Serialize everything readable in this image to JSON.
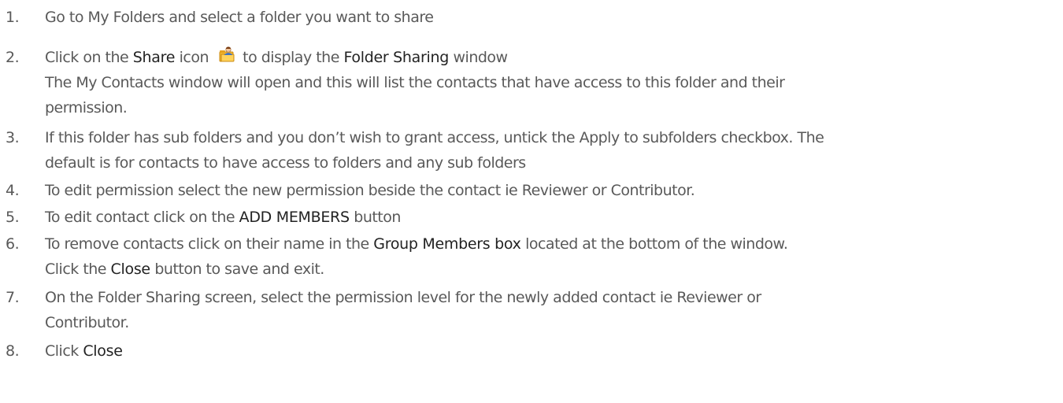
{
  "steps": [
    {
      "number": "1.",
      "parts": [
        "Go to My Folders and select a folder you want to share"
      ]
    },
    {
      "number": "2.",
      "parts": [
        "Click on the ",
        "Share",
        " icon ",
        " to display the ",
        "Folder Sharing",
        " window"
      ],
      "icon": "share-folder-icon",
      "continuation": [
        "The My Contacts window will open and this will list the contacts that have access to this folder and their",
        "permission."
      ]
    },
    {
      "number": "3.",
      "lines": [
        "If this folder has sub folders and you don’t wish to grant access, untick the Apply to subfolders checkbox. The",
        "default is for contacts to have access to folders and any sub folders"
      ]
    },
    {
      "number": "4.",
      "parts": [
        "To edit permission select the new permission beside the contact ie Reviewer or Contributor."
      ]
    },
    {
      "number": "5.",
      "parts": [
        "To edit contact click on the ",
        "ADD MEMBERS",
        " button"
      ]
    },
    {
      "number": "6.",
      "parts": [
        "To remove contacts click on their name in the ",
        "Group Members box",
        " located at the bottom of the window."
      ],
      "continuation_parts": [
        "Click the ",
        "Close",
        " button to save and exit."
      ]
    },
    {
      "number": "7.",
      "lines": [
        "On the Folder Sharing screen, select the permission level for the newly added contact ie Reviewer or",
        "Contributor."
      ]
    },
    {
      "number": "8.",
      "parts": [
        "Click ",
        "Close"
      ]
    }
  ]
}
